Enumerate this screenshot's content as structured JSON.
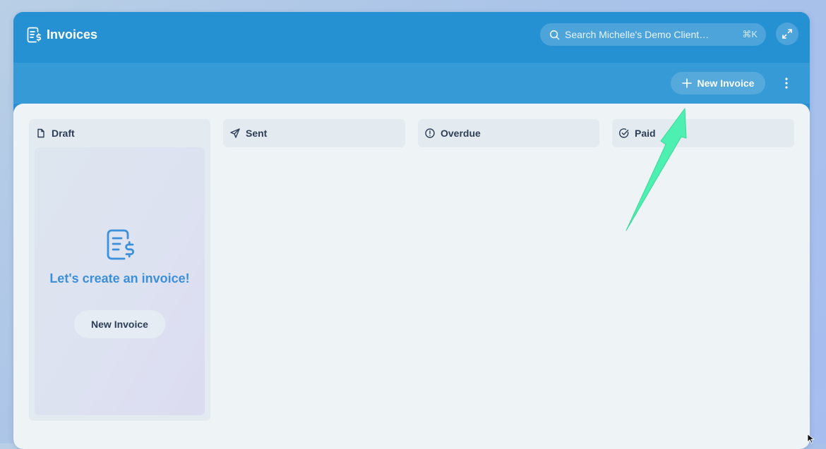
{
  "header": {
    "title": "Invoices",
    "app_icon": "invoice-dollar-icon",
    "search": {
      "placeholder": "Search Michelle's Demo Client…",
      "shortcut": "⌘K",
      "icon": "search-icon"
    },
    "expand_icon": "expand-icon"
  },
  "toolbar": {
    "new_invoice_label": "New Invoice",
    "plus_icon": "plus-icon",
    "more_icon": "vertical-dots-icon"
  },
  "columns": [
    {
      "label": "Draft",
      "icon": "document-icon"
    },
    {
      "label": "Sent",
      "icon": "send-icon"
    },
    {
      "label": "Overdue",
      "icon": "alert-circle-icon"
    },
    {
      "label": "Paid",
      "icon": "check-circle-icon"
    }
  ],
  "empty_state": {
    "icon": "invoice-dollar-icon",
    "message": "Let's create an invoice!",
    "button_label": "New Invoice"
  },
  "colors": {
    "header_bg": "#2591d3",
    "toolbar_bg": "#359ad5",
    "board_bg": "#eef3f6",
    "accent_text": "#3c8fd8",
    "annotation_arrow": "#4df0b0"
  }
}
